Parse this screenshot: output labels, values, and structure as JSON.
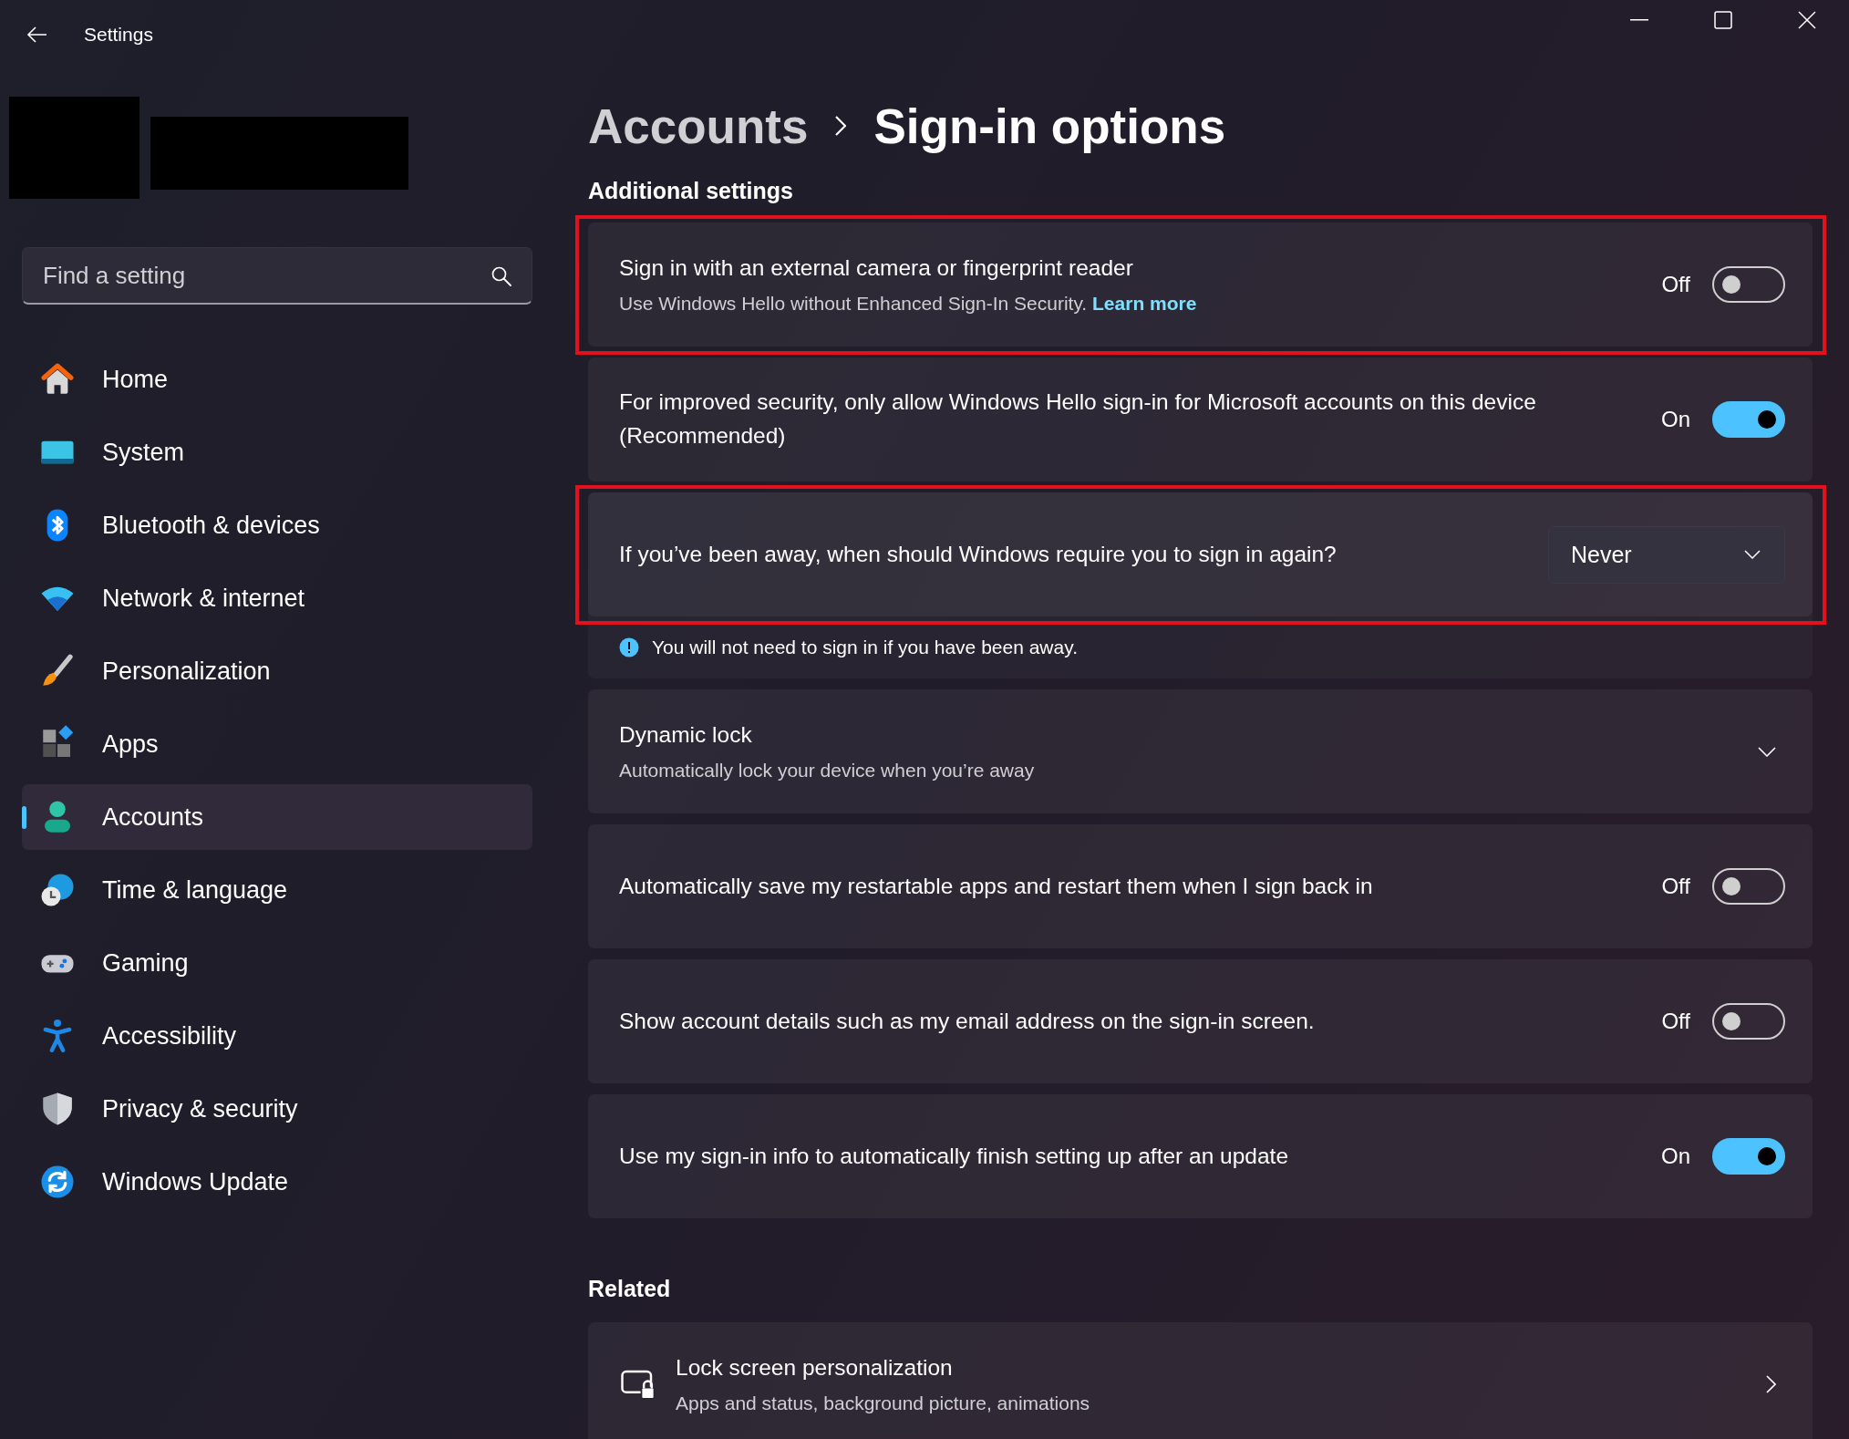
{
  "window": {
    "title": "Settings"
  },
  "search": {
    "placeholder": "Find a setting"
  },
  "nav": [
    {
      "label": "Home",
      "kind": "home",
      "selected": false
    },
    {
      "label": "System",
      "kind": "system",
      "selected": false
    },
    {
      "label": "Bluetooth & devices",
      "kind": "bluetooth",
      "selected": false
    },
    {
      "label": "Network & internet",
      "kind": "network",
      "selected": false
    },
    {
      "label": "Personalization",
      "kind": "personalization",
      "selected": false
    },
    {
      "label": "Apps",
      "kind": "apps",
      "selected": false
    },
    {
      "label": "Accounts",
      "kind": "accounts",
      "selected": true
    },
    {
      "label": "Time & language",
      "kind": "time",
      "selected": false
    },
    {
      "label": "Gaming",
      "kind": "gaming",
      "selected": false
    },
    {
      "label": "Accessibility",
      "kind": "accessibility",
      "selected": false
    },
    {
      "label": "Privacy & security",
      "kind": "privacy",
      "selected": false
    },
    {
      "label": "Windows Update",
      "kind": "update",
      "selected": false
    }
  ],
  "breadcrumb": {
    "parent": "Accounts",
    "current": "Sign-in options"
  },
  "sections": [
    {
      "heading": "Additional settings",
      "settings": [
        {
          "kind": "toggle",
          "title": "Sign in with an external camera or fingerprint reader",
          "description": "Use Windows Hello without Enhanced Sign-In Security.",
          "link": "Learn more",
          "state_label": "Off",
          "on": false,
          "highlighted": true
        },
        {
          "kind": "toggle",
          "title": "For improved security, only allow Windows Hello sign-in for Microsoft accounts on this device (Recommended)",
          "state_label": "On",
          "on": true,
          "highlighted": false
        },
        {
          "kind": "dropdown",
          "title": "If you’ve been away, when should Windows require you to sign in again?",
          "value": "Never",
          "note": "You will not need to sign in if you have been away.",
          "highlighted": true
        },
        {
          "kind": "expander",
          "title": "Dynamic lock",
          "description": "Automatically lock your device when you’re away",
          "expanded": false,
          "highlighted": false
        },
        {
          "kind": "toggle",
          "title": "Automatically save my restartable apps and restart them when I sign back in",
          "state_label": "Off",
          "on": false,
          "highlighted": false
        },
        {
          "kind": "toggle",
          "title": "Show account details such as my email address on the sign-in screen.",
          "state_label": "Off",
          "on": false,
          "highlighted": false
        },
        {
          "kind": "toggle",
          "title": "Use my sign-in info to automatically finish setting up after an update",
          "state_label": "On",
          "on": true,
          "highlighted": false
        }
      ]
    },
    {
      "heading": "Related",
      "settings": [
        {
          "kind": "link",
          "title": "Lock screen personalization",
          "description": "Apps and status, background picture, animations",
          "highlighted": false
        }
      ]
    }
  ]
}
